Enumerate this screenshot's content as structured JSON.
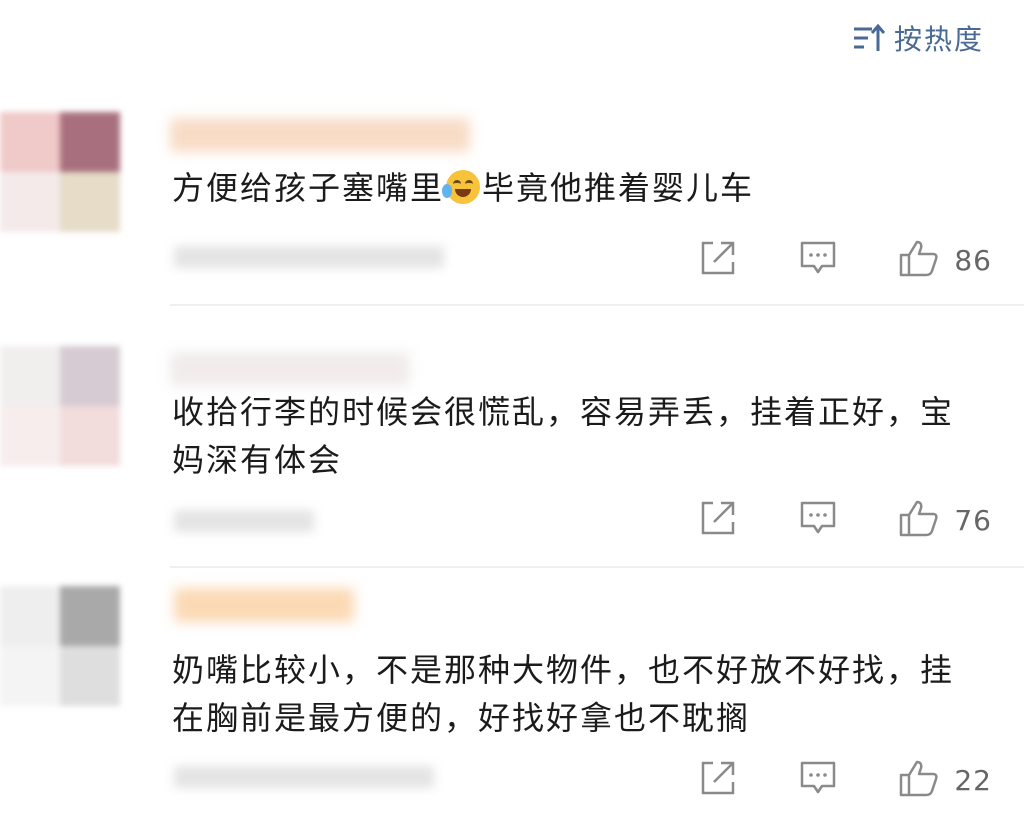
{
  "sort": {
    "label": "按热度",
    "icon": "sort-icon"
  },
  "comments": [
    {
      "text_before": "方便给孩子塞嘴里",
      "emoji": "crying-laughing-emoji",
      "text_after": "毕竟他推着婴儿车",
      "likes": "86"
    },
    {
      "text": "收拾行李的时候会很慌乱，容易弄丢，挂着正好，宝妈深有体会",
      "likes": "76"
    },
    {
      "text": "奶嘴比较小，不是那种大物件，也不好放不好找，挂在胸前是最方便的，好找好拿也不耽搁",
      "likes": "22"
    }
  ],
  "action_icons": {
    "share": "share-icon",
    "reply": "reply-icon",
    "like": "thumbs-up-icon"
  },
  "colors": {
    "accent": "#4a6a96",
    "icon": "#8a8a8a",
    "divider": "#efefef"
  }
}
